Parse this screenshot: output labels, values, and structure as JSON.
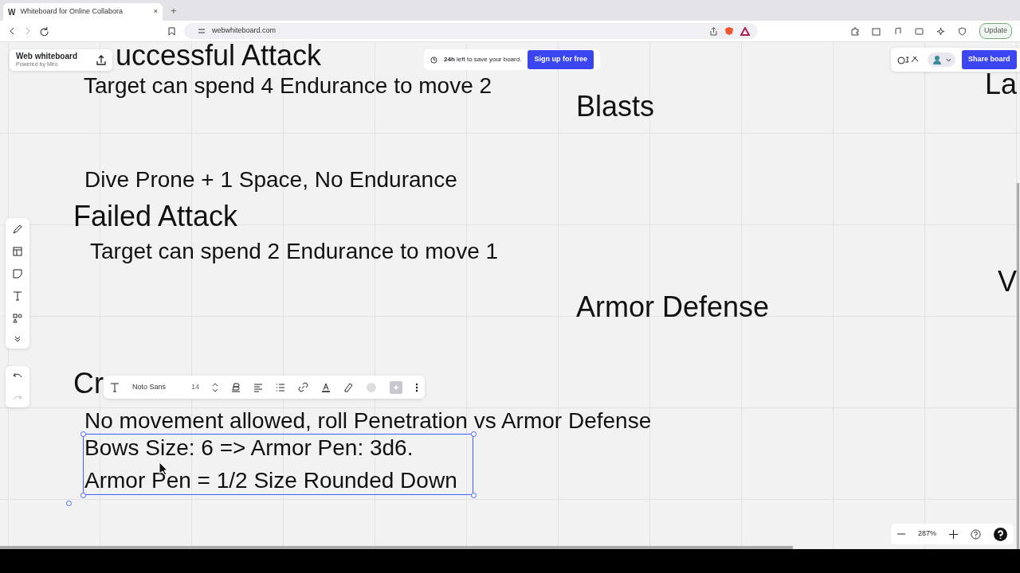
{
  "browser": {
    "tab_icon": "W",
    "tab_title": "Whiteboard for Online Collabora",
    "tab_close": "×",
    "new_tab": "+",
    "url": "webwhiteboard.com",
    "update_label": "Update"
  },
  "board": {
    "name": "Web whiteboard",
    "powered_by": "Powered by Miro"
  },
  "banner": {
    "text": "**24h** left to save your board.",
    "button": "Sign up for free"
  },
  "share_button": "Share board",
  "canvas_texts": [
    {
      "kind": "heading",
      "text": "uccessful Attack"
    },
    {
      "kind": "body",
      "text": "Target can spend 4 Endurance to move 2"
    },
    {
      "kind": "heading",
      "text": "Blasts"
    },
    {
      "kind": "body",
      "text": "Dive Prone + 1 Space, No Endurance"
    },
    {
      "kind": "heading",
      "text": "Failed Attack"
    },
    {
      "kind": "body",
      "text": "Target can spend 2 Endurance to move 1"
    },
    {
      "kind": "heading",
      "text": "Armor Defense"
    },
    {
      "kind": "heading",
      "text": "Cr"
    },
    {
      "kind": "body",
      "text": "No movement allowed, roll Penetration vs Armor Defense"
    },
    {
      "kind": "heading",
      "text": "La"
    },
    {
      "kind": "heading",
      "text": "V"
    }
  ],
  "selected_text": {
    "selected": true,
    "lines": [
      "Bows Size: 6 => Armor Pen: 3d6.",
      "Armor Pen = 1/2 Size Rounded Down"
    ]
  },
  "text_toolbar": {
    "font": "Noto Sans",
    "size": "14"
  },
  "zoom": "287%"
}
